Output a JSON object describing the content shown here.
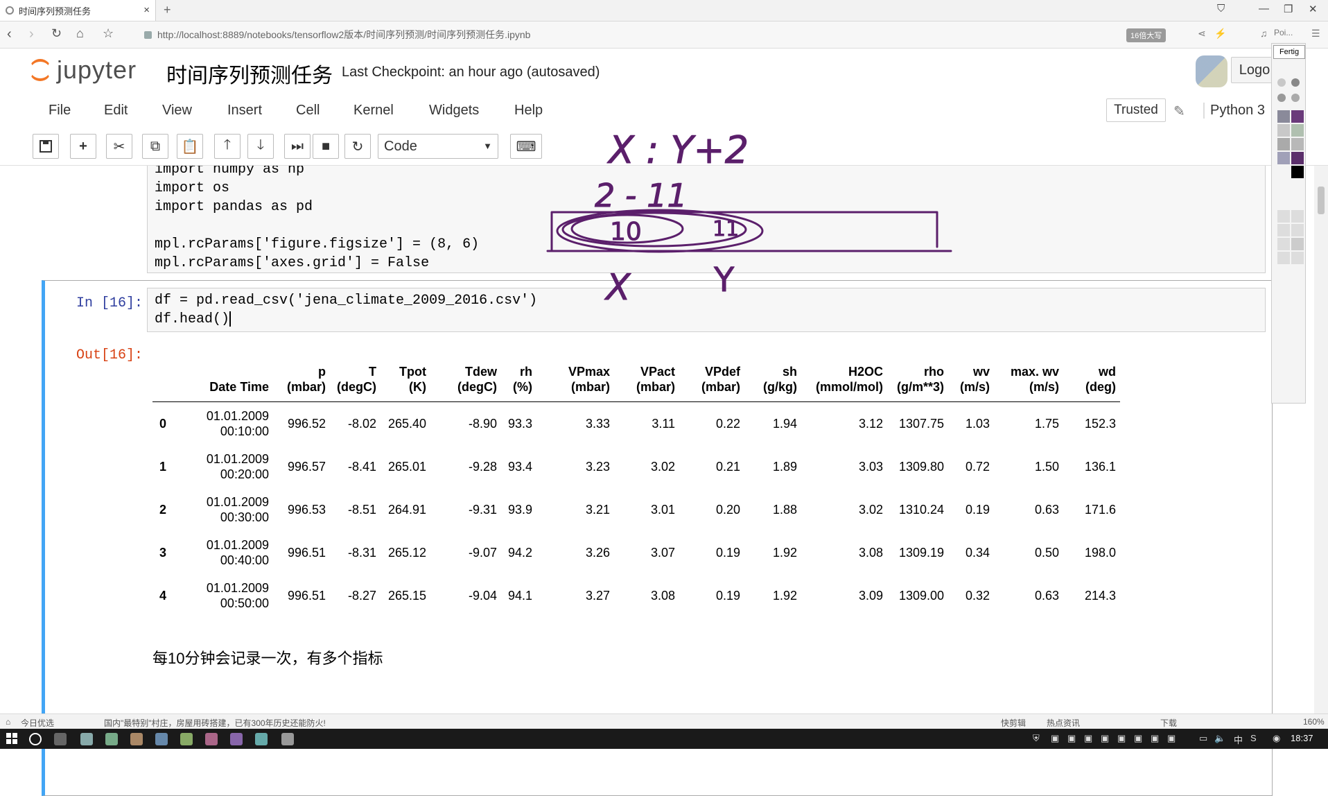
{
  "browser": {
    "tab_title": "时间序列预测任务",
    "tab_close": "×",
    "new_tab": "+",
    "url": "http://localhost:8889/notebooks/tensorflow2版本/时间序列预测/时间序列预测任务.ipynb",
    "speed_badge": "16倍大写",
    "addr_right_1": "Poi..."
  },
  "jupyter": {
    "logo_text": "jupyter",
    "notebook_name": "时间序列预测任务",
    "checkpoint": "Last Checkpoint: an hour ago (autosaved)",
    "logout": "Logo",
    "menu": [
      "File",
      "Edit",
      "View",
      "Insert",
      "Cell",
      "Kernel",
      "Widgets",
      "Help"
    ],
    "trusted": "Trusted",
    "kernel": "Python 3",
    "cell_type": "Code"
  },
  "prev_cell": {
    "lines": [
      "import numpy as np",
      "import os",
      "import pandas as pd",
      "",
      "mpl.rcParams['figure.figsize'] = (8, 6)",
      "mpl.rcParams['axes.grid'] = False"
    ]
  },
  "active_cell": {
    "in_prompt": "In [16]:",
    "out_prompt": "Out[16]:",
    "code_line_1": "df = pd.read_csv('jena_climate_2009_2016.csv')",
    "code_line_2": "df.head()"
  },
  "dataframe": {
    "columns": [
      [
        "",
        ""
      ],
      [
        "Date Time",
        ""
      ],
      [
        "p",
        "(mbar)"
      ],
      [
        "T",
        "(degC)"
      ],
      [
        "Tpot",
        "(K)"
      ],
      [
        "Tdew",
        "(degC)"
      ],
      [
        "rh",
        "(%)"
      ],
      [
        "VPmax",
        "(mbar)"
      ],
      [
        "VPact",
        "(mbar)"
      ],
      [
        "VPdef",
        "(mbar)"
      ],
      [
        "sh",
        "(g/kg)"
      ],
      [
        "H2OC",
        "(mmol/mol)"
      ],
      [
        "rho",
        "(g/m**3)"
      ],
      [
        "wv",
        "(m/s)"
      ],
      [
        "max. wv",
        "(m/s)"
      ],
      [
        "wd",
        "(deg)"
      ]
    ],
    "rows": [
      [
        "0",
        "01.01.2009\n00:10:00",
        "996.52",
        "-8.02",
        "265.40",
        "-8.90",
        "93.3",
        "3.33",
        "3.11",
        "0.22",
        "1.94",
        "3.12",
        "1307.75",
        "1.03",
        "1.75",
        "152.3"
      ],
      [
        "1",
        "01.01.2009\n00:20:00",
        "996.57",
        "-8.41",
        "265.01",
        "-9.28",
        "93.4",
        "3.23",
        "3.02",
        "0.21",
        "1.89",
        "3.03",
        "1309.80",
        "0.72",
        "1.50",
        "136.1"
      ],
      [
        "2",
        "01.01.2009\n00:30:00",
        "996.53",
        "-8.51",
        "264.91",
        "-9.31",
        "93.9",
        "3.21",
        "3.01",
        "0.20",
        "1.88",
        "3.02",
        "1310.24",
        "0.19",
        "0.63",
        "171.6"
      ],
      [
        "3",
        "01.01.2009\n00:40:00",
        "996.51",
        "-8.31",
        "265.12",
        "-9.07",
        "94.2",
        "3.26",
        "3.07",
        "0.19",
        "1.92",
        "3.08",
        "1309.19",
        "0.34",
        "0.50",
        "198.0"
      ],
      [
        "4",
        "01.01.2009\n00:50:00",
        "996.51",
        "-8.27",
        "265.15",
        "-9.04",
        "94.1",
        "3.27",
        "3.08",
        "0.19",
        "1.92",
        "3.09",
        "1309.00",
        "0.32",
        "0.63",
        "214.3"
      ]
    ]
  },
  "markdown_text": "每10分钟会记录一次，有多个指标",
  "annotations": {
    "line1": "X : Y+2",
    "line2": "2 - 11",
    "box_left": "10",
    "box_right": "11",
    "label_x": "X",
    "label_y": "Y",
    "ink_color": "#5b1f6b"
  },
  "palette": {
    "label": "Fertig"
  },
  "statusbar": {
    "left": "今日优选",
    "news": "国内\"最特别\"村庄，房屋用砖搭建，已有300年历史还能防火!",
    "quick": "快剪辑",
    "hot": "热点资讯",
    "download": "下载",
    "zoom": "160%"
  },
  "taskbar": {
    "clock": "18:37",
    "ime": "中"
  }
}
